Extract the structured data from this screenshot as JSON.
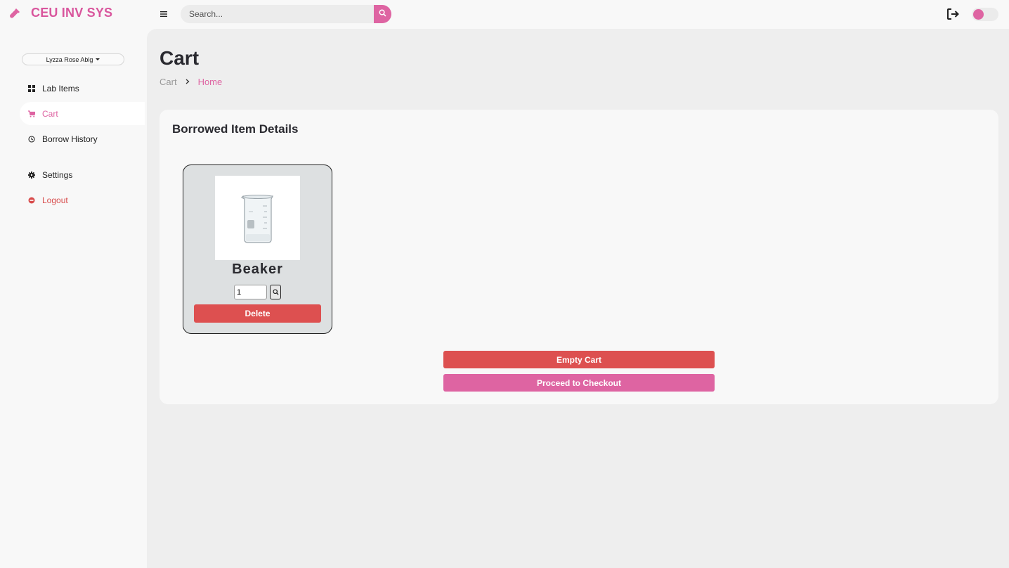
{
  "brand": {
    "name": "CEU INV SYS"
  },
  "search": {
    "placeholder": "Search..."
  },
  "user": {
    "name": "Lyzza Rose Ablg"
  },
  "sidebar": {
    "items": [
      {
        "label": "Lab Items",
        "icon": "grid-icon"
      },
      {
        "label": "Cart",
        "icon": "cart-icon",
        "active": true
      },
      {
        "label": "Borrow History",
        "icon": "history-icon"
      },
      {
        "label": "Settings",
        "icon": "gear-icon"
      },
      {
        "label": "Logout",
        "icon": "logout-circle-icon"
      }
    ]
  },
  "page": {
    "title": "Cart",
    "breadcrumb": {
      "current": "Cart",
      "link": "Home"
    }
  },
  "panel": {
    "title": "Borrowed Item Details",
    "items": [
      {
        "name": "Beaker",
        "quantity": "1",
        "delete_label": "Delete"
      }
    ],
    "empty_label": "Empty Cart",
    "checkout_label": "Proceed to Checkout"
  },
  "colors": {
    "accent": "#de64a2",
    "danger": "#dd5050",
    "content_bg": "#eeeeee",
    "panel_bg": "#f8f8f8"
  }
}
